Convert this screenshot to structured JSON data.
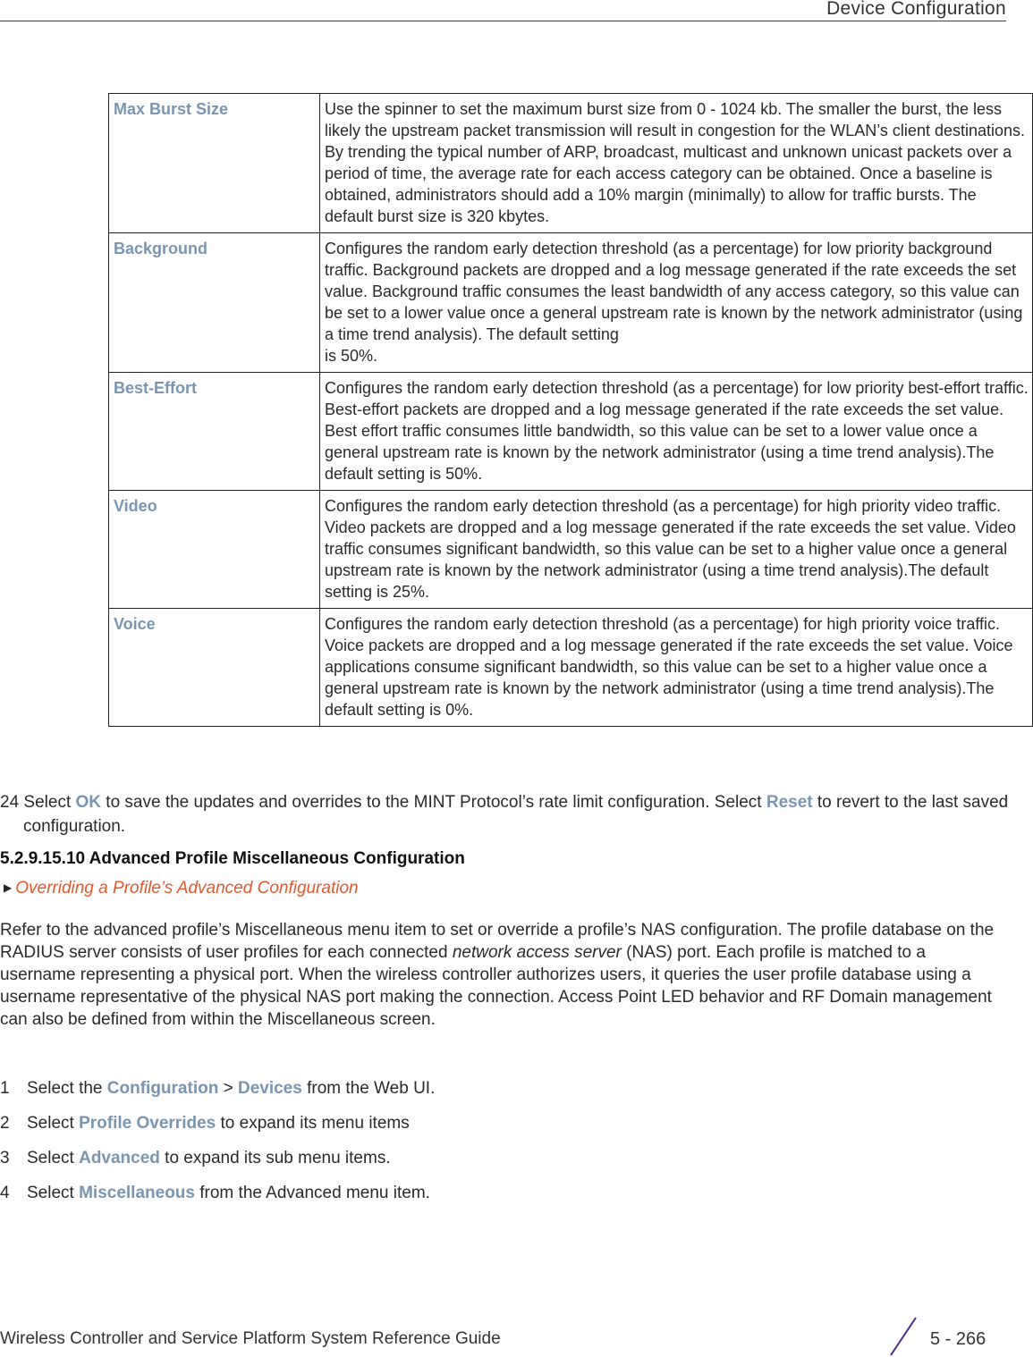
{
  "header": {
    "title": "Device Configuration",
    "rule_color": "#4b2a8f"
  },
  "parameters_table": {
    "rows": [
      {
        "term": "Max Burst Size",
        "description": "Use the spinner to set the maximum burst size from 0 - 1024 kb. The smaller the burst, the less likely the upstream packet transmission will result in congestion for the WLAN’s client destinations. By trending the typical number of ARP, broadcast, multicast and unknown unicast packets over a period of time, the average rate for each access category can be obtained. Once a baseline is obtained, administrators should add a 10% margin (minimally) to allow for traffic bursts. The default burst size is 320 kbytes."
      },
      {
        "term": "Background",
        "description": "Configures the random early detection threshold (as a percentage) for low priority background traffic. Background packets are dropped and a log message generated if the rate exceeds the set value. Background traffic consumes the least bandwidth of any access category, so this value can be set to a lower value once a general upstream rate is known by the network administrator (using a time trend analysis). The default setting",
        "description_tail": "is 50%."
      },
      {
        "term": "Best-Effort",
        "description": "Configures the random early detection threshold (as a percentage) for low priority best-effort traffic. Best-effort packets are dropped and a log message generated if the rate exceeds the set value. Best effort traffic consumes little bandwidth, so this value can be set to a lower value once a general upstream rate is known by the network administrator (using a time trend analysis).The default setting is 50%."
      },
      {
        "term": "Video",
        "description": "Configures the random early detection threshold (as a percentage) for high priority video traffic. Video packets are dropped and a log message generated if the rate exceeds the set value. Video traffic consumes significant bandwidth, so this value can be set to a higher value once a general upstream rate is known by the network administrator (using a time trend analysis).The default setting is 25%."
      },
      {
        "term": "Voice",
        "description": "Configures the random early detection threshold (as a percentage) for high priority voice traffic. Voice packets are dropped and a log message generated if the rate exceeds the set value. Voice applications consume significant bandwidth, so this value can be set to a higher value once a general upstream rate is known by the network administrator (using a time trend analysis).The default setting is 0%."
      }
    ]
  },
  "step_24": {
    "number": "24",
    "part1": "Select ",
    "ok": "OK",
    "part2": " to save the updates and overrides to the MINT Protocol’s rate limit configuration. Select ",
    "reset": "Reset",
    "part3": " to revert to the last saved configuration."
  },
  "section": {
    "heading": "5.2.9.15.10 Advanced Profile Miscellaneous Configuration",
    "xref_arrow": "▶",
    "xref_link": "Overriding a Profile’s Advanced Configuration",
    "xref_color": "#e8572c",
    "intro_part1": "Refer to the advanced profile’s Miscellaneous menu item to set or override a profile’s NAS configuration. The profile database on the RADIUS server consists of user profiles for each connected ",
    "intro_em": "network access server",
    "intro_part2": " (NAS) port. Each profile is matched to a username representing a physical port. When the wireless controller authorizes users, it queries the user profile database using a username representative of the physical NAS port making the connection. Access Point LED behavior and RF Domain management can also be defined from within the Miscellaneous screen."
  },
  "steps": [
    {
      "num": "1",
      "pre": "Select the ",
      "ui1": "Configuration",
      "mid": " > ",
      "ui2": "Devices",
      "post": " from the Web UI."
    },
    {
      "num": "2",
      "pre": "Select ",
      "ui1": "Profile Overrides",
      "post": " to expand its menu items"
    },
    {
      "num": "3",
      "pre": "Select ",
      "ui1": "Advanced",
      "post": " to expand its sub menu items."
    },
    {
      "num": "4",
      "pre": "Select ",
      "ui1": "Miscellaneous",
      "post": " from the Advanced menu item."
    }
  ],
  "footer": {
    "guide_title": "Wireless Controller and Service Platform System Reference Guide",
    "page_number": "5 - 266"
  },
  "colors": {
    "ui_label": "#7a95b0",
    "accent": "#4b2a8f"
  }
}
